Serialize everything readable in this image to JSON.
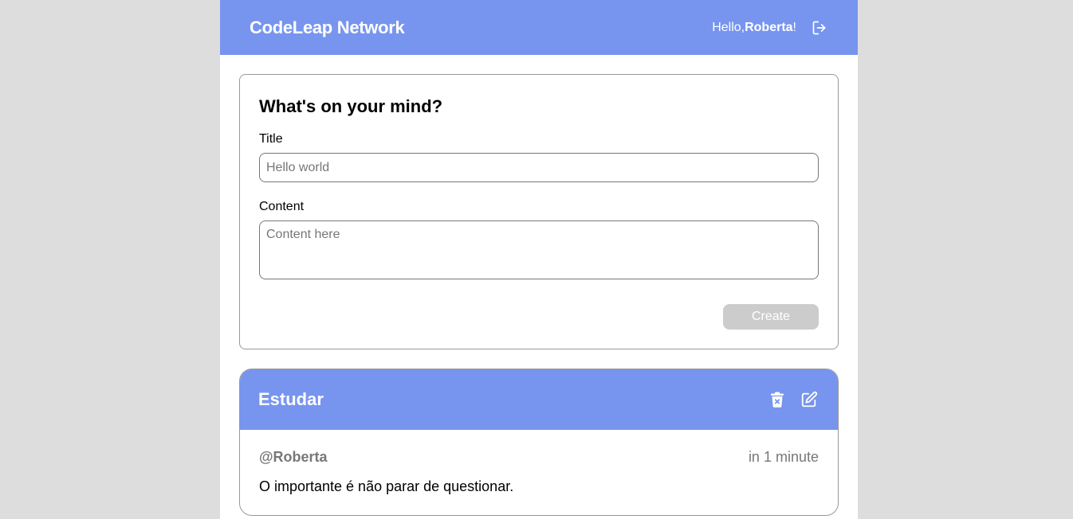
{
  "header": {
    "brand": "CodeLeap Network",
    "greeting_prefix": "Hello,",
    "username": "Roberta",
    "greeting_suffix": "!",
    "logout_icon": "logout-icon"
  },
  "form": {
    "heading": "What's on your mind?",
    "title_label": "Title",
    "title_placeholder": "Hello world",
    "title_value": "",
    "content_label": "Content",
    "content_placeholder": "Content here",
    "content_value": "",
    "create_label": "Create",
    "create_enabled": false
  },
  "posts": [
    {
      "title": "Estudar",
      "author": "@Roberta",
      "time": "in 1 minute",
      "content": "O importante é não parar de questionar.",
      "actions": [
        "delete-icon",
        "edit-icon"
      ]
    }
  ],
  "colors": {
    "primary": "#7795ee",
    "page_background": "#dddddd",
    "card_border": "#999999",
    "muted_text": "#777777",
    "disabled_button": "#cccccc"
  }
}
